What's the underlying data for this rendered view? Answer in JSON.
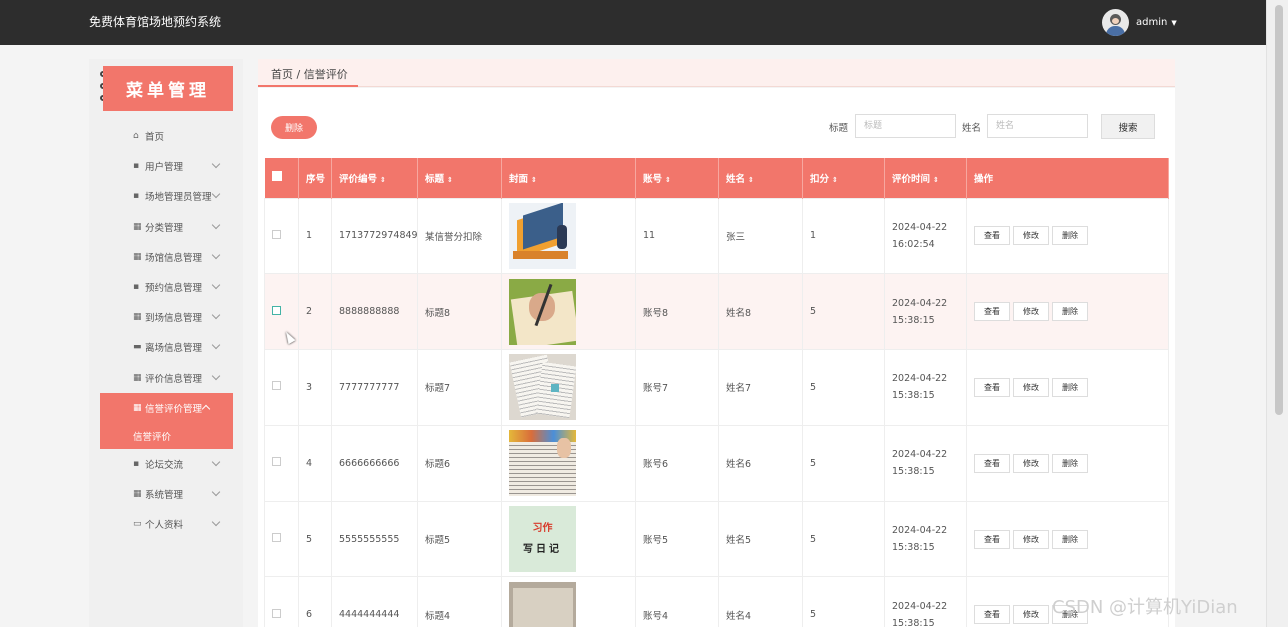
{
  "app": {
    "title": "免费体育馆场地预约系统",
    "username": "admin"
  },
  "sidebar": {
    "title": "菜单管理",
    "items": [
      {
        "label": "首页",
        "icon": "home-icon",
        "glyph": "⌂"
      },
      {
        "label": "用户管理",
        "icon": "clipboard-icon",
        "glyph": "▪"
      },
      {
        "label": "场地管理员管理",
        "icon": "chat-icon",
        "glyph": "▪"
      },
      {
        "label": "分类管理",
        "icon": "grid-icon",
        "glyph": "▦"
      },
      {
        "label": "场馆信息管理",
        "icon": "grid-icon",
        "glyph": "▦"
      },
      {
        "label": "预约信息管理",
        "icon": "image-icon",
        "glyph": "▪"
      },
      {
        "label": "到场信息管理",
        "icon": "grid-icon",
        "glyph": "▦"
      },
      {
        "label": "离场信息管理",
        "icon": "car-icon",
        "glyph": "▬"
      },
      {
        "label": "评价信息管理",
        "icon": "grid-icon",
        "glyph": "▦"
      },
      {
        "label": "信誉评价管理",
        "icon": "grid-icon",
        "glyph": "▦"
      },
      {
        "label": "论坛交流",
        "icon": "chat-icon",
        "glyph": "▪"
      },
      {
        "label": "系统管理",
        "icon": "grid-icon",
        "glyph": "▦"
      },
      {
        "label": "个人资料",
        "icon": "calendar-icon",
        "glyph": "▭"
      }
    ],
    "sub_item": "信誉评价"
  },
  "breadcrumb": "首页 / 信誉评价",
  "toolbar": {
    "delete_label": "删除",
    "search_label": "搜索"
  },
  "search": {
    "title_label": "标题",
    "title_placeholder": "标题",
    "name_label": "姓名",
    "name_placeholder": "姓名"
  },
  "table": {
    "headers": [
      "序号",
      "评价编号",
      "标题",
      "封面",
      "账号",
      "姓名",
      "扣分",
      "评价时间",
      "操作"
    ],
    "actions": [
      "查看",
      "修改",
      "删除"
    ],
    "rows": [
      {
        "no": "1",
        "code": "1713772974849",
        "title": "某信誉分扣除",
        "account": "11",
        "name": "张三",
        "deduct": "1",
        "time": "2024-04-22 16:02:54"
      },
      {
        "no": "2",
        "code": "8888888888",
        "title": "标题8",
        "account": "账号8",
        "name": "姓名8",
        "deduct": "5",
        "time": "2024-04-22 15:38:15"
      },
      {
        "no": "3",
        "code": "7777777777",
        "title": "标题7",
        "account": "账号7",
        "name": "姓名7",
        "deduct": "5",
        "time": "2024-04-22 15:38:15"
      },
      {
        "no": "4",
        "code": "6666666666",
        "title": "标题6",
        "account": "账号6",
        "name": "姓名6",
        "deduct": "5",
        "time": "2024-04-22 15:38:15"
      },
      {
        "no": "5",
        "code": "5555555555",
        "title": "标题5",
        "account": "账号5",
        "name": "姓名5",
        "deduct": "5",
        "time": "2024-04-22 15:38:15"
      },
      {
        "no": "6",
        "code": "4444444444",
        "title": "标题4",
        "account": "账号4",
        "name": "姓名4",
        "deduct": "5",
        "time": "2024-04-22 15:38:15"
      }
    ],
    "cover5_line1": "习作",
    "cover5_line2": "写日记"
  },
  "watermark": "CSDN @计算机YiDian",
  "colors": {
    "accent": "#f2766b",
    "topbar": "#2d2d2d"
  }
}
